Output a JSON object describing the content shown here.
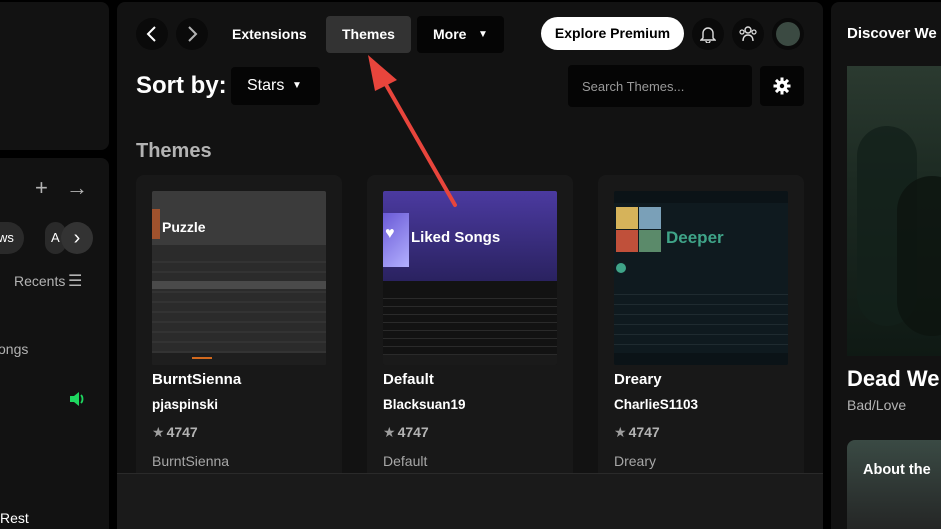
{
  "left_library": {
    "chip_partial": "ws",
    "chip_partial_2": "A",
    "recents_label": "Recents",
    "list_item_partial": "ongs",
    "bottom_partial": "Rest",
    "accent_color": "#1ed760"
  },
  "header": {
    "tabs": [
      {
        "label": "Extensions"
      },
      {
        "label": "Themes"
      },
      {
        "label": "More"
      }
    ],
    "premium_label": "Explore Premium"
  },
  "toolbar": {
    "sort_label": "Sort by:",
    "sort_value": "Stars",
    "search_placeholder": "Search Themes..."
  },
  "section_title": "Themes",
  "cards": [
    {
      "title": "BurntSienna",
      "author": "pjaspinski",
      "stars": "4747",
      "description": "BurntSienna",
      "thumb_heading": "Puzzle"
    },
    {
      "title": "Default",
      "author": "Blacksuan19",
      "stars": "4747",
      "description": "Default",
      "thumb_heading": "Liked Songs"
    },
    {
      "title": "Dreary",
      "author": "CharlieS1103",
      "stars": "4747",
      "description": "Dreary",
      "thumb_heading": "Deeper"
    }
  ],
  "right_panel": {
    "title": "Discover We",
    "artist": "Dead We",
    "subtitle": "Bad/Love",
    "card_label": "About the"
  },
  "annotation_color": "#e8453c"
}
